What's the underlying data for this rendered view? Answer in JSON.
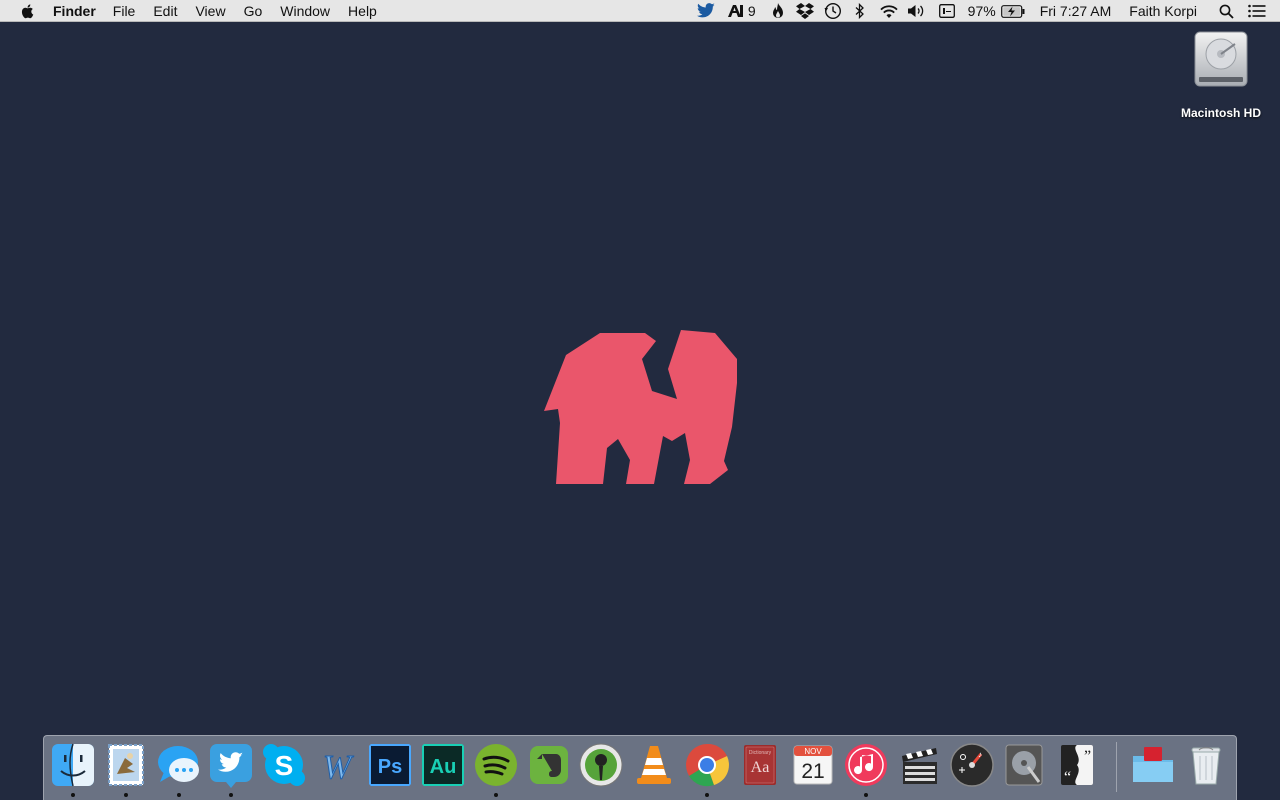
{
  "menubar": {
    "app_name": "Finder",
    "menus": [
      "File",
      "Edit",
      "View",
      "Go",
      "Window",
      "Help"
    ],
    "status": {
      "notification_count": "9",
      "battery": "97%",
      "clock": "Fri 7:27 AM",
      "user": "Faith Korpi"
    }
  },
  "desktop": {
    "drive_label": "Macintosh HD",
    "wallpaper_color": "#222a3f",
    "logo_color": "#ea566b"
  },
  "dock": {
    "apps": [
      {
        "name": "Finder",
        "running": true
      },
      {
        "name": "Mail",
        "running": true
      },
      {
        "name": "Messages",
        "running": true
      },
      {
        "name": "Twitter",
        "running": true
      },
      {
        "name": "Skype",
        "running": false
      },
      {
        "name": "Microsoft Word",
        "running": false
      },
      {
        "name": "Adobe Photoshop",
        "running": false
      },
      {
        "name": "Adobe Audition",
        "running": false
      },
      {
        "name": "Spotify",
        "running": true
      },
      {
        "name": "Evernote",
        "running": false
      },
      {
        "name": "Podcast app",
        "running": false
      },
      {
        "name": "VLC",
        "running": false
      },
      {
        "name": "Google Chrome",
        "running": true
      },
      {
        "name": "Dictionary",
        "running": false
      },
      {
        "name": "Calendar",
        "running": false
      },
      {
        "name": "iTunes",
        "running": true
      },
      {
        "name": "Final Cut Pro",
        "running": false
      },
      {
        "name": "Dashboard",
        "running": false
      },
      {
        "name": "Disk Utility",
        "running": false
      },
      {
        "name": "Quotes app",
        "running": false
      },
      {
        "name": "Downloads folder",
        "running": false
      },
      {
        "name": "Trash",
        "running": false
      }
    ],
    "icon_text": {
      "photoshop": "Ps",
      "audition": "Au",
      "dictionary_book": "Aa",
      "dictionary_spine": "Dictionary",
      "calendar_month": "NOV",
      "calendar_day": "21"
    }
  }
}
